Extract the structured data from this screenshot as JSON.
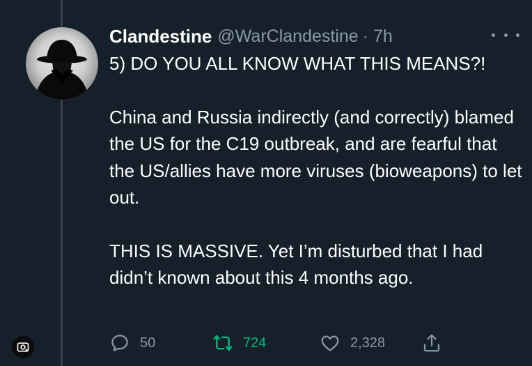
{
  "tweet": {
    "author": {
      "name": "Clandestine",
      "handle": "@WarClandestine",
      "time": "· 7h"
    },
    "paragraphs": [
      "5) DO YOU ALL KNOW WHAT THIS MEANS?!",
      "China and Russia indirectly (and correctly) blamed the US for the C19 outbreak, and are fearful that the US/allies have more viruses (bioweapons) to let out.",
      "THIS IS MASSIVE. Yet I’m disturbed that I had didn’t known about this 4 months ago."
    ],
    "actions": {
      "replies": "50",
      "retweets": "724",
      "likes": "2,328"
    }
  },
  "colors": {
    "background": "#15202b",
    "secondary_text": "#8b98a5",
    "retweet_green": "#00ba7c",
    "thread_line": "#38444d"
  },
  "icons": [
    "more-icon",
    "reply-icon",
    "retweet-icon",
    "like-icon",
    "share-icon",
    "lens-icon"
  ]
}
